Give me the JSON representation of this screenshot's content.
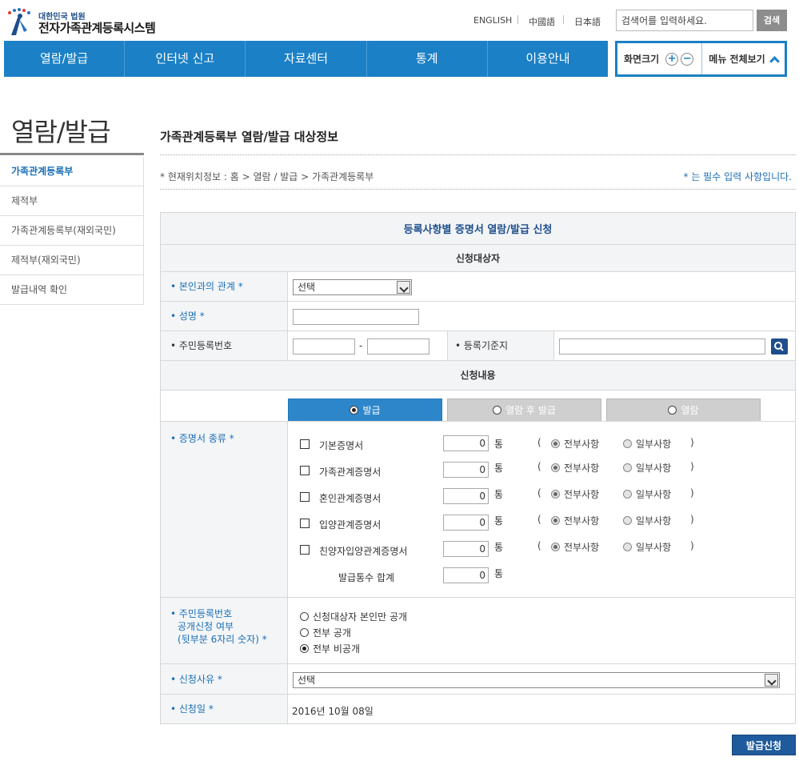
{
  "header": {
    "logo_sub": "대한민국 법원",
    "logo_title": "전자가족관계등록시스템",
    "languages": [
      "ENGLISH",
      "中國語",
      "日本語"
    ],
    "search_placeholder": "검색어를 입력하세요.",
    "search_button": "검색"
  },
  "gnb": [
    "열람/발급",
    "인터넷 신고",
    "자료센터",
    "통계",
    "이용안내"
  ],
  "util": {
    "zoom_label": "화면크기",
    "plus": "+",
    "minus": "−",
    "menu_all": "메뉴 전체보기"
  },
  "side": {
    "title": "열람/발급",
    "items": [
      "가족관계등록부",
      "제적부",
      "가족관계등록부(재외국민)",
      "제적부(재외국민)",
      "발급내역 확인"
    ]
  },
  "main": {
    "title": "가족관계등록부 열람/발급 대상정보",
    "location": "* 현재위치정보 : 홈 > 열람 / 발급 > 가족관계등록부",
    "required_note": "* 는 필수 입력 사항입니다."
  },
  "form": {
    "heading": "등록사항별 증명서 열람/발급 신청",
    "section_target": "신청대상자",
    "relation_label": "• 본인과의 관계 *",
    "relation_value": "선택",
    "name_label": "• 성명 *",
    "rrn_label": "• 주민등록번호",
    "rrn_dash": "-",
    "base_label": "• 등록기준지",
    "section_content": "신청내용",
    "tabs": [
      "발급",
      "열람 후 발급",
      "열람"
    ],
    "cert_label": "• 증명서 종류 *",
    "certs": [
      {
        "name": "기본증명서",
        "count": "0"
      },
      {
        "name": "가족관계증명서",
        "count": "0"
      },
      {
        "name": "혼인관계증명서",
        "count": "0"
      },
      {
        "name": "입양관계증명서",
        "count": "0"
      },
      {
        "name": "친양자입양관계증명서",
        "count": "0"
      }
    ],
    "unit": "통",
    "paren_open": "(",
    "paren_close": ")",
    "scope_all": "전부사항",
    "scope_part": "일부사항",
    "total_label": "발급통수 합계",
    "total_value": "0",
    "disclosure_label_1": "• 주민등록번호",
    "disclosure_label_2": "공개신청 여부",
    "disclosure_label_3": "(뒷부분 6자리 숫자) *",
    "disclosure_options": [
      "신청대상자 본인만 공개",
      "전부 공개",
      "전부 비공개"
    ],
    "reason_label": "• 신청사유 *",
    "reason_value": "선택",
    "date_label": "• 신청일 *",
    "date_value": "2016년 10월 08일"
  },
  "submit_label": "발급신청",
  "colors": {
    "primary": "#1b80c6",
    "accent_text": "#1b6fb8",
    "submit": "#1f5b9c"
  }
}
